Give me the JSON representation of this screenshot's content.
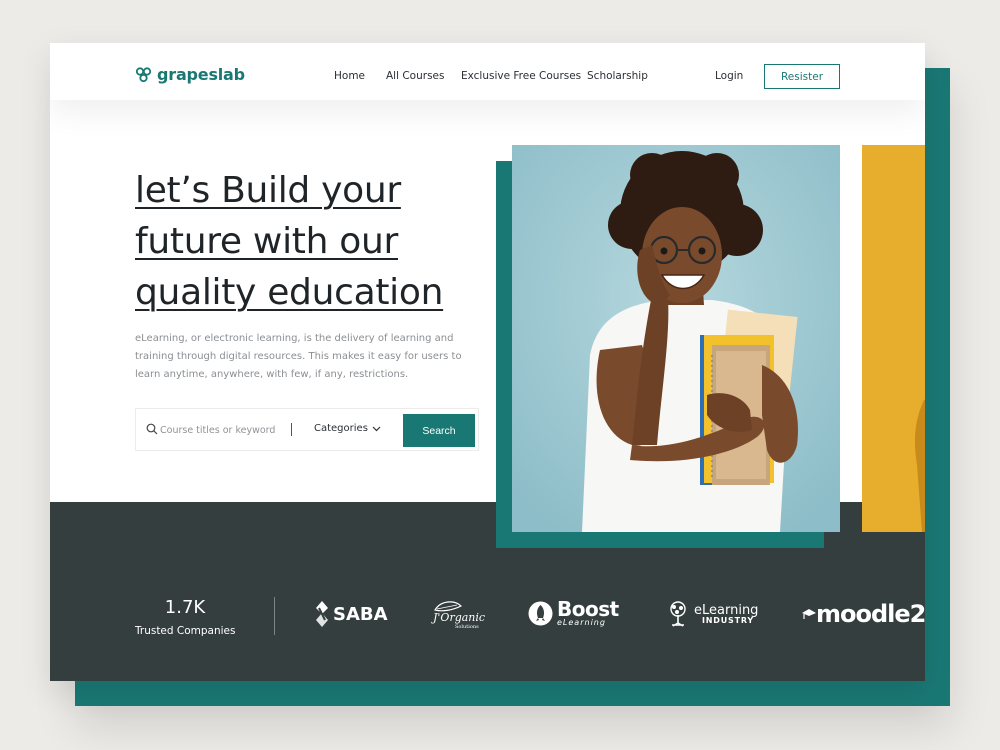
{
  "brand": {
    "name": "grapeslab"
  },
  "nav": {
    "items": [
      "Home",
      "All Courses",
      "Exclusive Free Courses",
      "Scholarship"
    ],
    "login": "Login",
    "register": "Resister"
  },
  "hero": {
    "headline_lines": [
      "let’s Build your",
      "future with our",
      "quality education"
    ],
    "description": "eLearning, or electronic learning, is the delivery of learning and training through digital resources. This makes it easy for users to learn anytime, anywhere, with few, if any, restrictions."
  },
  "search": {
    "placeholder": "Course titles or keyword",
    "categories_label": "Categories",
    "button_label": "Search"
  },
  "stats": {
    "value": "1.7K",
    "label": "Trusted Companies"
  },
  "partners": {
    "saba": "SABA",
    "jorganic_main": "J'Organic",
    "jorganic_sub": "Solutions",
    "boost_main": "Boost",
    "boost_sub": "eLearning",
    "elearning_main": "eLearning",
    "elearning_sub": "INDUSTRY",
    "moodle": "moodle"
  },
  "colors": {
    "accent": "#1a7874",
    "band": "#353e3e",
    "photo_bg": "#a6cdd6",
    "side_photo_bg": "#e7ae2d"
  }
}
